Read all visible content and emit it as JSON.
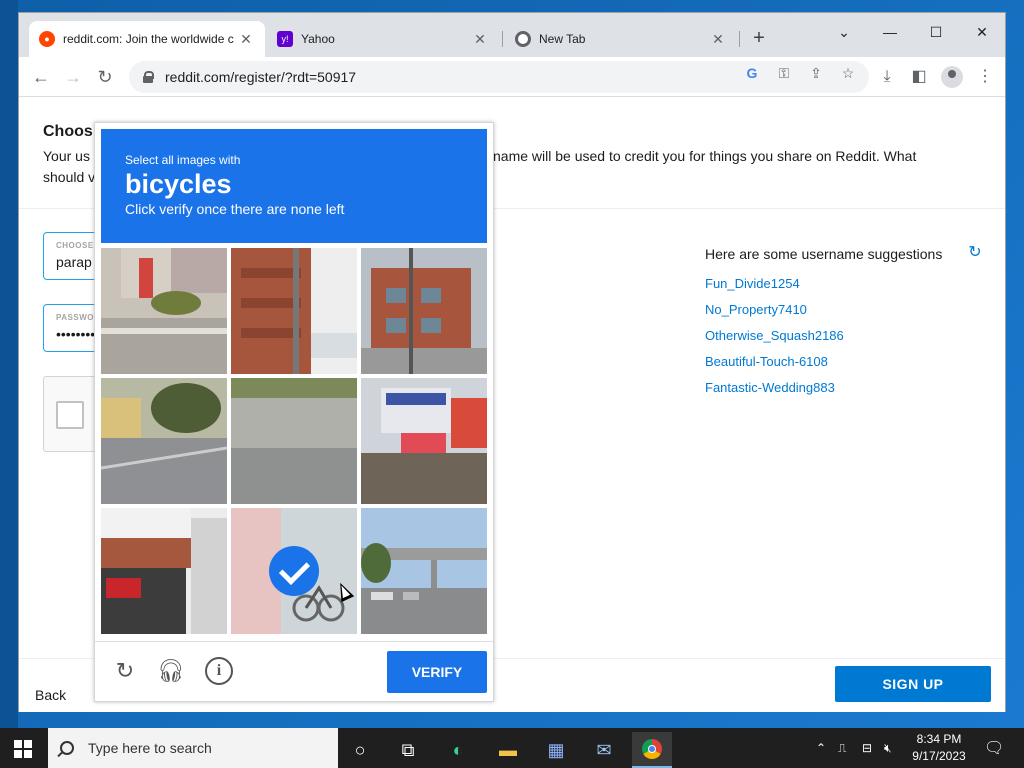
{
  "browser": {
    "tabs": [
      {
        "label": "reddit.com: Join the worldwide c",
        "active": true
      },
      {
        "label": "Yahoo",
        "active": false
      },
      {
        "label": "New Tab",
        "active": false
      }
    ],
    "url": "reddit.com/register/?rdt=50917"
  },
  "page": {
    "title": "Choos",
    "description_left": "Your us",
    "description_left2": "should v",
    "description_right": "name will be used to credit you for things you share on Reddit. What",
    "username_label": "CHOOSE",
    "username_value": "parap",
    "password_label": "PASSWO",
    "password_value": "••••••••",
    "suggestions_heading": "Here are some username suggestions",
    "suggestions": [
      "Fun_Divide1254",
      "No_Property7410",
      "Otherwise_Squash2186",
      "Beautiful-Touch-6108",
      "Fantastic-Wedding883"
    ],
    "back_label": "Back",
    "signup_label": "SIGN UP"
  },
  "captcha": {
    "instruction": "Select all images with",
    "target": "bicycles",
    "subtext": "Click verify once there are none left",
    "verify_label": "VERIFY",
    "selected_tile": 7
  },
  "taskbar": {
    "search_placeholder": "Type here to search",
    "time": "8:34 PM",
    "date": "9/17/2023"
  },
  "colors": {
    "captcha_blue": "#1a73e8",
    "reddit_blue": "#0079d3"
  }
}
